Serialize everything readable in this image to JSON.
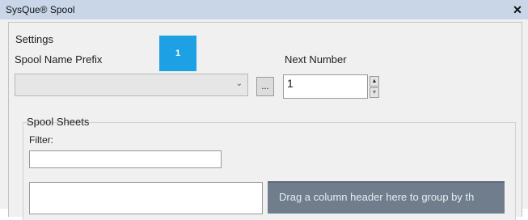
{
  "window": {
    "title": "SysQue® Spool",
    "close_glyph": "✕"
  },
  "settings": {
    "group_label": "Settings",
    "prefix_label": "Spool Name Prefix",
    "prefix_value": "",
    "browse_label": "...",
    "next_number_label": "Next Number",
    "next_number_value": "1",
    "badge": "1"
  },
  "spool_sheets": {
    "group_label": "Spool Sheets",
    "filter_label": "Filter:",
    "filter_value": "",
    "group_panel_text": "Drag a column header here to group by th"
  }
}
